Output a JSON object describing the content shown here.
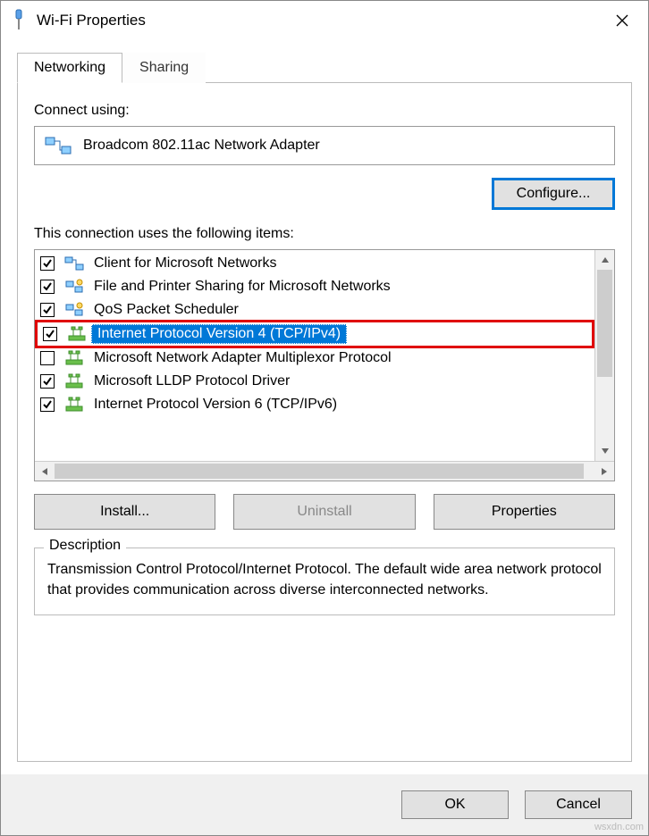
{
  "window": {
    "title": "Wi-Fi Properties"
  },
  "tabs": {
    "networking": "Networking",
    "sharing": "Sharing"
  },
  "adapter": {
    "connect_using_label": "Connect using:",
    "name": "Broadcom 802.11ac Network Adapter",
    "configure_btn": "Configure..."
  },
  "items_label": "This connection uses the following items:",
  "items": [
    {
      "checked": true,
      "icon": "client",
      "label": "Client for Microsoft Networks"
    },
    {
      "checked": true,
      "icon": "service",
      "label": "File and Printer Sharing for Microsoft Networks"
    },
    {
      "checked": true,
      "icon": "service",
      "label": "QoS Packet Scheduler"
    },
    {
      "checked": true,
      "icon": "protocol",
      "label": "Internet Protocol Version 4 (TCP/IPv4)",
      "selected": true,
      "highlighted": true
    },
    {
      "checked": false,
      "icon": "protocol",
      "label": "Microsoft Network Adapter Multiplexor Protocol"
    },
    {
      "checked": true,
      "icon": "protocol",
      "label": "Microsoft LLDP Protocol Driver"
    },
    {
      "checked": true,
      "icon": "protocol",
      "label": "Internet Protocol Version 6 (TCP/IPv6)"
    }
  ],
  "buttons": {
    "install": "Install...",
    "uninstall": "Uninstall",
    "properties": "Properties"
  },
  "description": {
    "legend": "Description",
    "text": "Transmission Control Protocol/Internet Protocol. The default wide area network protocol that provides communication across diverse interconnected networks."
  },
  "footer": {
    "ok": "OK",
    "cancel": "Cancel"
  },
  "watermark": "wsxdn.com"
}
